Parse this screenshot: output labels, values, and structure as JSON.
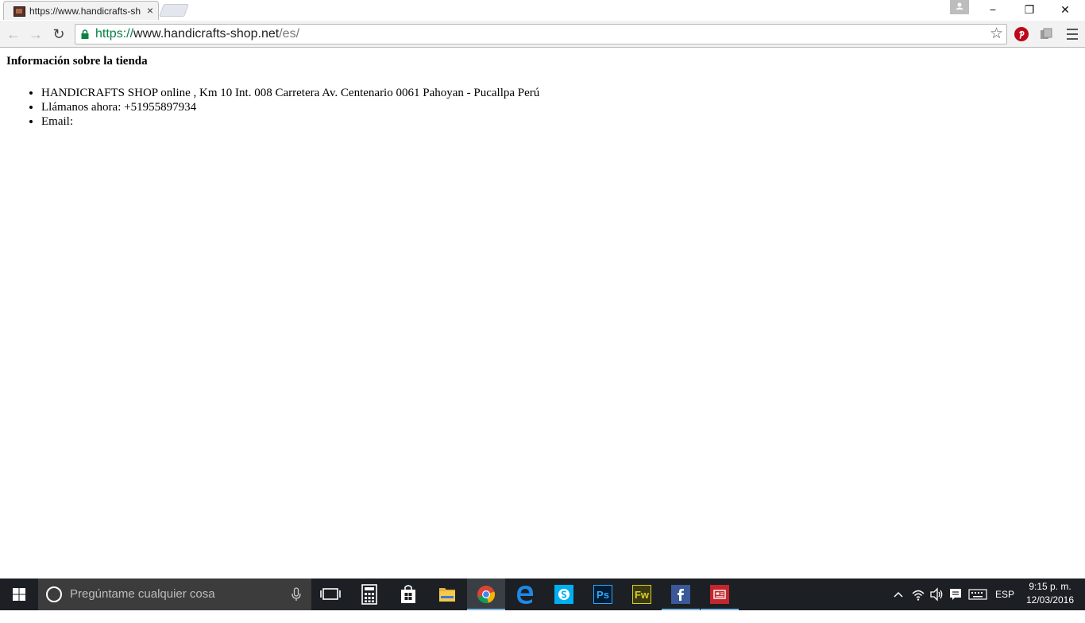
{
  "browser": {
    "tab": {
      "title": "https://www.handicrafts-sh"
    },
    "address": {
      "scheme": "https://",
      "host": "www.handicrafts-shop.net",
      "path": "/es/"
    },
    "icons": {
      "close": "×",
      "minimize": "−",
      "restore": "❐",
      "window_close": "✕",
      "back": "←",
      "forward": "→",
      "reload": "↻",
      "star": "☆"
    }
  },
  "page": {
    "heading": "Información sobre la tienda",
    "items": [
      "HANDICRAFTS SHOP online , Km 10 Int. 008 Carretera Av. Centenario 0061 Pahoyan - Pucallpa Perú",
      "Llámanos ahora: +51955897934",
      "Email:"
    ]
  },
  "taskbar": {
    "search_placeholder": "Pregúntame cualquier cosa",
    "language": "ESP",
    "time": "9:15 p. m.",
    "date": "12/03/2016",
    "apps": [
      "task-view",
      "calculator",
      "store",
      "file-explorer",
      "chrome",
      "edge",
      "skype",
      "photoshop",
      "fireworks",
      "facebook",
      "news"
    ],
    "fireworks_label": "Fw",
    "photoshop_label": "Ps"
  },
  "colors": {
    "secure_green": "#0b8043",
    "taskbar": "#1c1f24",
    "pinterest": "#bd081c"
  }
}
